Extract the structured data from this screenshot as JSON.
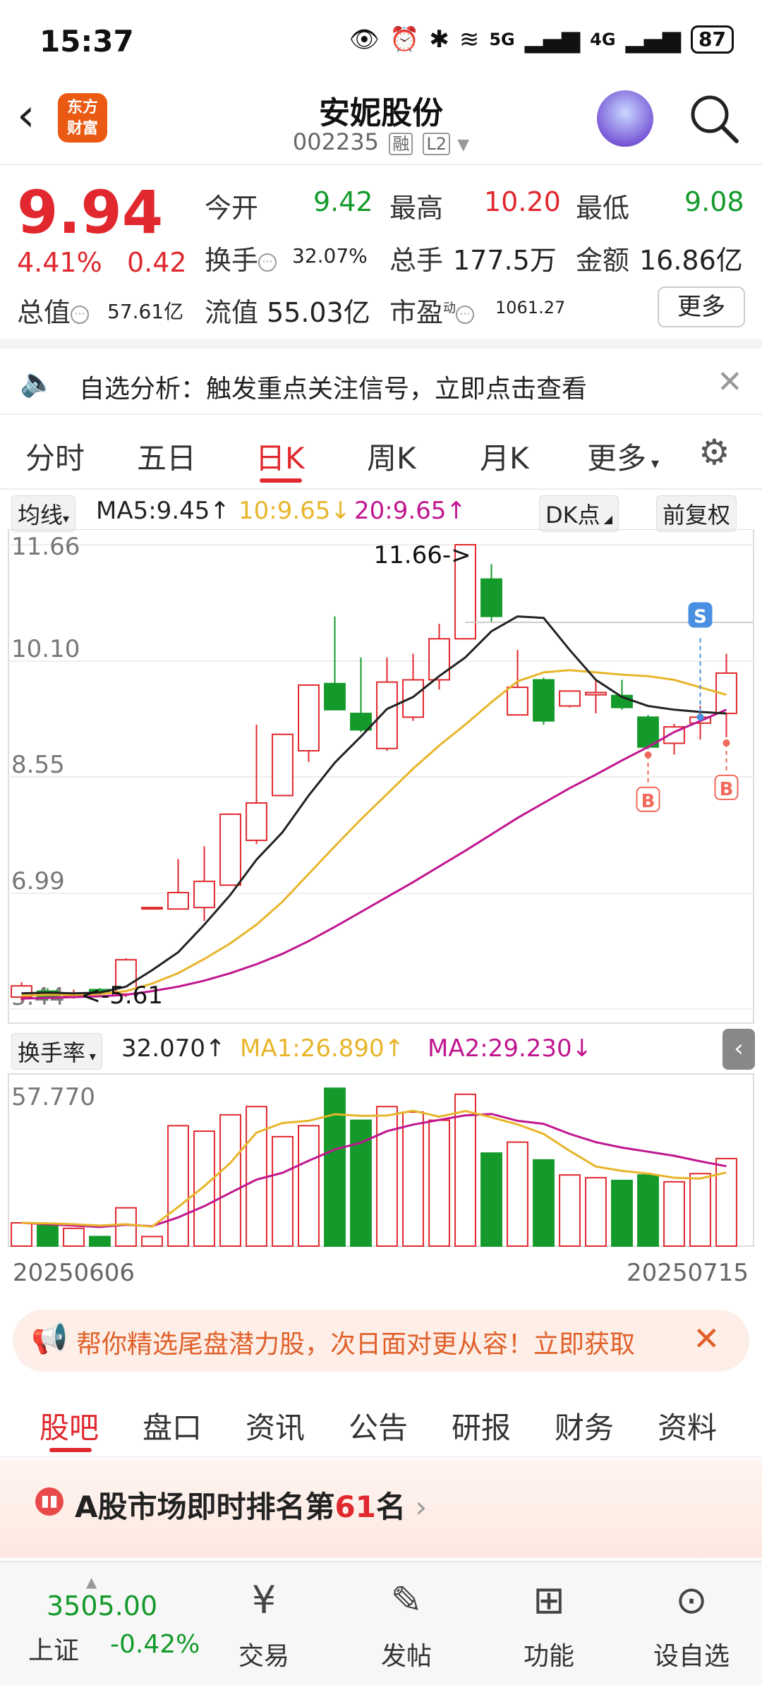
{
  "status": {
    "time": "15:37",
    "battery": "87",
    "net1": "5G",
    "net2": "4G"
  },
  "header": {
    "title": "安妮股份",
    "code": "002235",
    "tag1": "融",
    "tag2": "L2",
    "back": "‹",
    "logo_line1": "东方",
    "logo_line2": "财富"
  },
  "quote": {
    "price": "9.94",
    "pct": "4.41%",
    "chg": "0.42",
    "open_label": "今开",
    "open": "9.42",
    "high_label": "最高",
    "high": "10.20",
    "low_label": "最低",
    "low": "9.08",
    "turnover_label": "换手",
    "turnover": "32.07%",
    "volume_label": "总手",
    "volume": "177.5万",
    "amount_label": "金额",
    "amount": "16.86亿",
    "mktcap_label": "总值",
    "mktcap": "57.61亿",
    "float_label": "流值",
    "float": "55.03亿",
    "pe_label": "市盈",
    "pe_sup": "动",
    "pe": "1061.27",
    "more": "更多"
  },
  "notice": {
    "text": "自选分析：触发重点关注信号，立即点击查看"
  },
  "period_tabs": [
    "分时",
    "五日",
    "日K",
    "周K",
    "月K",
    "更多"
  ],
  "chart_data": {
    "type": "candlestick",
    "indicator_label": "均线",
    "ma5": "MA5:9.45",
    "ma10": "10:9.65",
    "ma20": "20:9.65",
    "dk_label": "DK点",
    "adjust_label": "前复权",
    "y_ticks": [
      "11.66",
      "10.10",
      "8.55",
      "6.99",
      "5.44"
    ],
    "ylim": [
      5.44,
      11.66
    ],
    "max_annotation": "11.66->",
    "min_annotation": "<-5.61",
    "candles": [
      {
        "o": 5.6,
        "c": 5.75,
        "h": 5.8,
        "l": 5.55
      },
      {
        "o": 5.68,
        "c": 5.6,
        "h": 5.72,
        "l": 5.55
      },
      {
        "o": 5.62,
        "c": 5.64,
        "h": 5.7,
        "l": 5.58
      },
      {
        "o": 5.7,
        "c": 5.65,
        "h": 5.72,
        "l": 5.6
      },
      {
        "o": 5.64,
        "c": 6.1,
        "h": 6.12,
        "l": 5.6
      },
      {
        "o": 6.8,
        "c": 6.8,
        "h": 6.8,
        "l": 6.8
      },
      {
        "o": 6.78,
        "c": 7.0,
        "h": 7.45,
        "l": 6.78
      },
      {
        "o": 6.8,
        "c": 7.15,
        "h": 7.62,
        "l": 6.62
      },
      {
        "o": 7.1,
        "c": 8.05,
        "h": 8.05,
        "l": 7.1
      },
      {
        "o": 7.7,
        "c": 8.2,
        "h": 9.25,
        "l": 7.65
      },
      {
        "o": 8.3,
        "c": 9.12,
        "h": 9.12,
        "l": 8.3
      },
      {
        "o": 8.9,
        "c": 9.78,
        "h": 9.78,
        "l": 8.75
      },
      {
        "o": 9.8,
        "c": 9.45,
        "h": 10.7,
        "l": 9.45
      },
      {
        "o": 9.4,
        "c": 9.18,
        "h": 10.15,
        "l": 9.15
      },
      {
        "o": 8.93,
        "c": 9.82,
        "h": 10.15,
        "l": 8.9
      },
      {
        "o": 9.35,
        "c": 9.85,
        "h": 10.2,
        "l": 9.3
      },
      {
        "o": 9.85,
        "c": 10.4,
        "h": 10.6,
        "l": 9.72
      },
      {
        "o": 10.4,
        "c": 11.66,
        "h": 11.66,
        "l": 10.4
      },
      {
        "o": 11.2,
        "c": 10.7,
        "h": 11.4,
        "l": 10.62
      },
      {
        "o": 9.38,
        "c": 9.75,
        "h": 10.25,
        "l": 9.38
      },
      {
        "o": 9.85,
        "c": 9.3,
        "h": 9.88,
        "l": 9.25
      },
      {
        "o": 9.5,
        "c": 9.7,
        "h": 9.7,
        "l": 9.48
      },
      {
        "o": 9.65,
        "c": 9.68,
        "h": 9.85,
        "l": 9.4
      },
      {
        "o": 9.64,
        "c": 9.48,
        "h": 9.85,
        "l": 9.45
      },
      {
        "o": 9.35,
        "c": 8.95,
        "h": 9.38,
        "l": 8.92
      },
      {
        "o": 9.0,
        "c": 9.22,
        "h": 9.26,
        "l": 8.85
      },
      {
        "o": 9.27,
        "c": 9.35,
        "h": 9.5,
        "l": 9.05
      },
      {
        "o": 9.4,
        "c": 9.94,
        "h": 10.2,
        "l": 9.08
      }
    ],
    "ma5_line": [
      5.65,
      5.66,
      5.65,
      5.66,
      5.74,
      5.96,
      6.2,
      6.57,
      6.97,
      7.44,
      7.81,
      8.3,
      8.74,
      9.09,
      9.46,
      9.62,
      9.9,
      10.15,
      10.5,
      10.7,
      10.68,
      10.25,
      9.85,
      9.62,
      9.5,
      9.45,
      9.42,
      9.4
    ],
    "ma10_line": [
      5.62,
      5.63,
      5.63,
      5.64,
      5.68,
      5.78,
      5.92,
      6.11,
      6.32,
      6.57,
      6.88,
      7.25,
      7.62,
      7.98,
      8.32,
      8.66,
      8.97,
      9.25,
      9.55,
      9.83,
      9.95,
      9.98,
      9.95,
      9.92,
      9.9,
      9.85,
      9.75,
      9.65
    ],
    "ma20_line": [
      5.58,
      5.59,
      5.6,
      5.61,
      5.63,
      5.68,
      5.74,
      5.82,
      5.92,
      6.04,
      6.18,
      6.35,
      6.54,
      6.74,
      6.94,
      7.14,
      7.35,
      7.56,
      7.78,
      8.0,
      8.2,
      8.4,
      8.58,
      8.77,
      8.95,
      9.15,
      9.3,
      9.45
    ],
    "signals": [
      {
        "index": 26,
        "label": "S"
      },
      {
        "index": 24,
        "label": "B"
      },
      {
        "index": 27,
        "label": "B"
      }
    ],
    "sub": {
      "indicator_label": "换手率",
      "value": "32.070",
      "ma1": "MA1:26.890",
      "ma2": "MA2:29.230",
      "y_max_label": "57.770",
      "ylim": [
        0,
        57.77
      ],
      "bars": [
        8.5,
        7.5,
        6.5,
        3.5,
        14,
        3.5,
        44,
        42,
        48,
        51,
        40,
        44,
        57.7,
        46,
        51,
        49,
        46,
        55.5,
        34,
        38,
        31.5,
        26,
        25,
        24,
        26,
        23.5,
        26.5,
        32
      ],
      "ma1_line": [
        8.5,
        8.3,
        8.0,
        7.5,
        8.0,
        7.1,
        14.3,
        21.9,
        30.4,
        41.5,
        45.0,
        45.8,
        48.2,
        47.6,
        47.7,
        49.5,
        47.3,
        49.4,
        47.1,
        44.5,
        41.0,
        34.8,
        29.1,
        27.5,
        26.5,
        25.0,
        24.7,
        26.9
      ],
      "ma2_line": [
        8.5,
        8.0,
        7.5,
        7.0,
        7.8,
        7.3,
        10.5,
        14.6,
        19.5,
        24.3,
        26.8,
        31.2,
        35.3,
        37.8,
        42.0,
        44.4,
        46.1,
        47.8,
        48.3,
        45.8,
        44.7,
        41.0,
        38.0,
        36.0,
        34.5,
        33.0,
        31.0,
        29.2
      ]
    },
    "x_start": "20250606",
    "x_end": "20250715"
  },
  "promo": {
    "text": "帮你精选尾盘潜力股，次日面对更从容！立即获取"
  },
  "info_tabs": [
    "股吧",
    "盘口",
    "资讯",
    "公告",
    "研报",
    "财务",
    "资料"
  ],
  "rank": {
    "prefix": "A股市场即时排名第",
    "num": "61",
    "suffix": "名"
  },
  "bottom": {
    "index_value": "3505.00",
    "index_name": "上证",
    "index_pct": "-0.42%",
    "buttons": [
      "交易",
      "发帖",
      "功能",
      "设自选"
    ]
  },
  "colors": {
    "up": "#e0282e",
    "down": "#149a2b",
    "ma5": "#222222",
    "ma10": "#e8b52a",
    "ma20": "#c0168f",
    "signal_s": "#4a90e2",
    "signal_b": "#f06a5a"
  }
}
